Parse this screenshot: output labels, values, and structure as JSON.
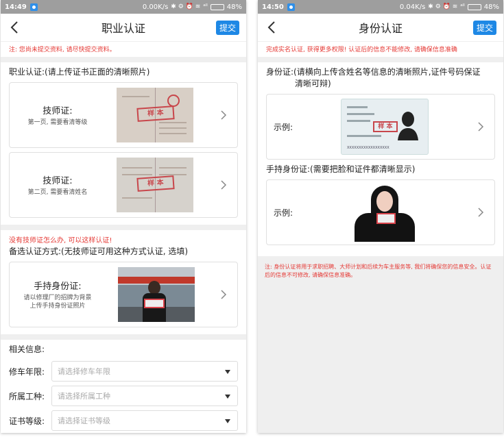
{
  "left": {
    "status": {
      "time": "14:49",
      "speed": "0.00K/s",
      "icons": "✱ ⚙ ⏰ ≋",
      "signal": "ᵃˡˡ",
      "battery_text": "48%",
      "battery_level": 0.48
    },
    "nav": {
      "title": "职业认证",
      "submit": "提交"
    },
    "notice": "注: 您尚未提交资料, 请尽快提交资料。",
    "section1": {
      "title": "职业认证:(请上传证书正面的清晰照片)",
      "cards": [
        {
          "title": "技师证:",
          "sub": "第一页, 需要看清等级",
          "stamp": "样 本"
        },
        {
          "title": "技师证:",
          "sub": "第二页, 需要看清姓名",
          "stamp": "样 本"
        }
      ]
    },
    "section2": {
      "hint": "没有技师证怎么办, 可以这样认证!",
      "title": "备选认证方式:(无技师证可用这种方式认证, 选填)",
      "card": {
        "title": "手持身份证:",
        "sub1": "请以修理厂的招牌为背景",
        "sub2": "上传手持身份证照片"
      }
    },
    "info": {
      "title": "相关信息:",
      "rows": [
        {
          "label": "修车年限:",
          "placeholder": "请选择修车年限"
        },
        {
          "label": "所属工种:",
          "placeholder": "请选择所属工种"
        },
        {
          "label": "证书等级:",
          "placeholder": "请选择证书等级"
        }
      ]
    }
  },
  "right": {
    "status": {
      "time": "14:50",
      "speed": "0.04K/s",
      "icons": "✱ ⚙ ⏰ ≋",
      "signal": "ᵃˡˡ",
      "battery_text": "48%",
      "battery_level": 0.48
    },
    "nav": {
      "title": "身份认证",
      "submit": "提交"
    },
    "notice": "完成实名认证, 获得更多权限! 认证后的信息不能修改, 请确保信息准确",
    "id_section": {
      "title_line1": "身份证:(请横向上传含姓名等信息的清晰照片,证件号码保证",
      "title_line2": "清晰可辩)",
      "example_label": "示例:",
      "stamp": "样 本",
      "id_number": "XXXXXXXXXXXXXXXXXX"
    },
    "hold_section": {
      "title": "手持身份证:(需要把脸和证件都清晰显示)",
      "example_label": "示例:"
    },
    "footnote": "注: 身份认证将用于求职招聘、大师计划和后续为车主服务等, 我们将确保您的信息安全。认证后的信息不可修改, 请确保信息准确。"
  },
  "colors": {
    "accent": "#1e88e5",
    "warning": "#e53935",
    "statusbar": "#9e9e9e",
    "battery": "#4cd964"
  }
}
